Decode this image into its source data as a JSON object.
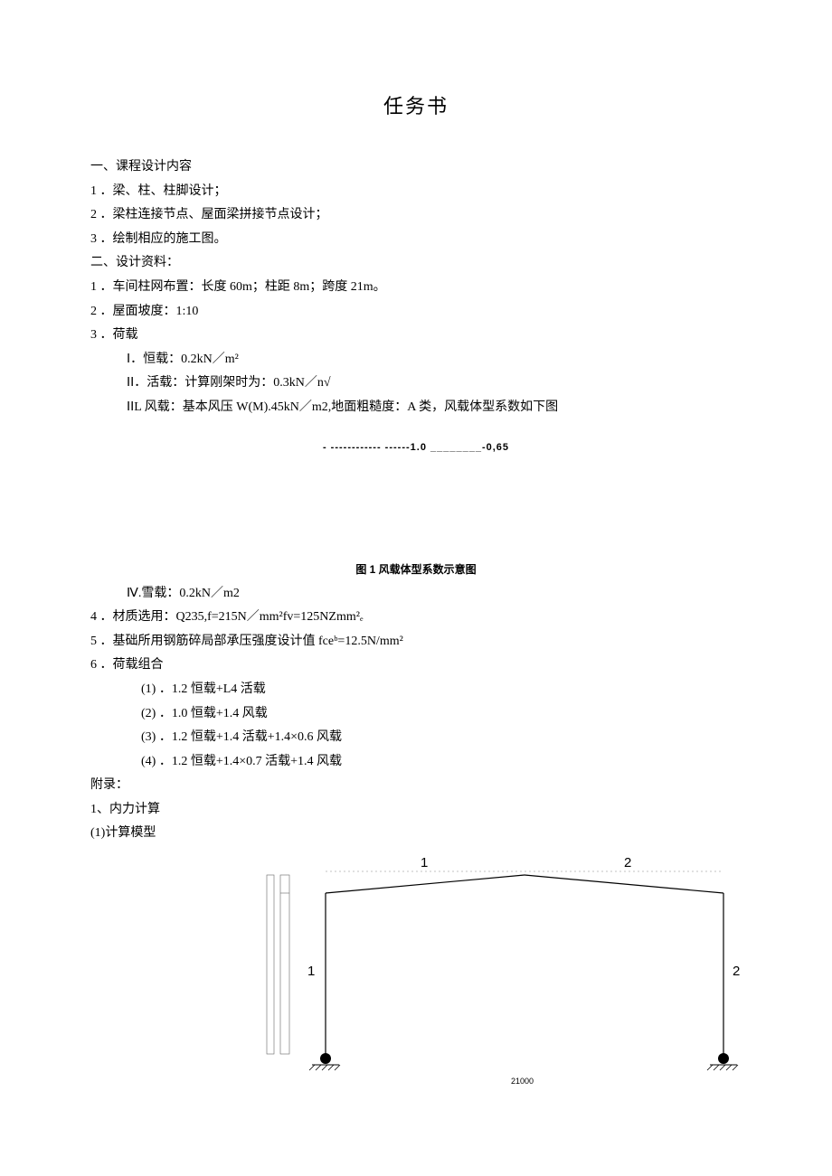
{
  "title": "任务书",
  "s1": {
    "heading": "一、课程设计内容",
    "item1": "1 ．梁、柱、柱脚设计；",
    "item2": "2 ．梁柱连接节点、屋面梁拼接节点设计；",
    "item3": "3 ．绘制相应的施工图。"
  },
  "s2": {
    "heading": "二、设计资料：",
    "item1": "1 ．车间柱网布置：长度 60m；柱距 8m；跨度 21m。",
    "item2": "2 ．屋面坡度：1:10",
    "item3": "3 ．荷载",
    "load_I": "Ⅰ．恒载：0.2kN／m²",
    "load_II": "ⅠⅠ．活载：计算刚架时为：0.3kN／n√",
    "load_III": "ⅠⅠL 风载：基本风压 W(M).45kN／m2,地面粗糙度：A 类，风载体型系数如下图",
    "wind_values": "- ------------ ------1.0                    ________-0,65",
    "wind_caption": "图 1 风载体型系数示意图",
    "load_IV": "Ⅳ.雪载：0.2kN／m2",
    "item4": "4 ．材质选用：Q235,f=215N／mm²fv=125NZmm²ₑ",
    "item5": "5 ．基础所用钢筋碎局部承压强度设计值 fceᵇ=12.5N/mm²",
    "item6": "6 ．荷载组合",
    "combo1": "(1) ．1.2 恒载+L4 活载",
    "combo2": "(2) ．1.0 恒载+1.4 风载",
    "combo3": "(3) ．1.2 恒载+1.4 活载+1.4×0.6 风载",
    "combo4": "(4) ．1.2 恒载+1.4×0.7 活载+1.4 风载"
  },
  "appendix": {
    "heading": "附录：",
    "item1": "1、内力计算",
    "sub1": "(1)计算模型"
  },
  "diagram": {
    "beam1": "1",
    "beam2": "2",
    "col1": "1",
    "col2": "2",
    "span": "21000"
  }
}
